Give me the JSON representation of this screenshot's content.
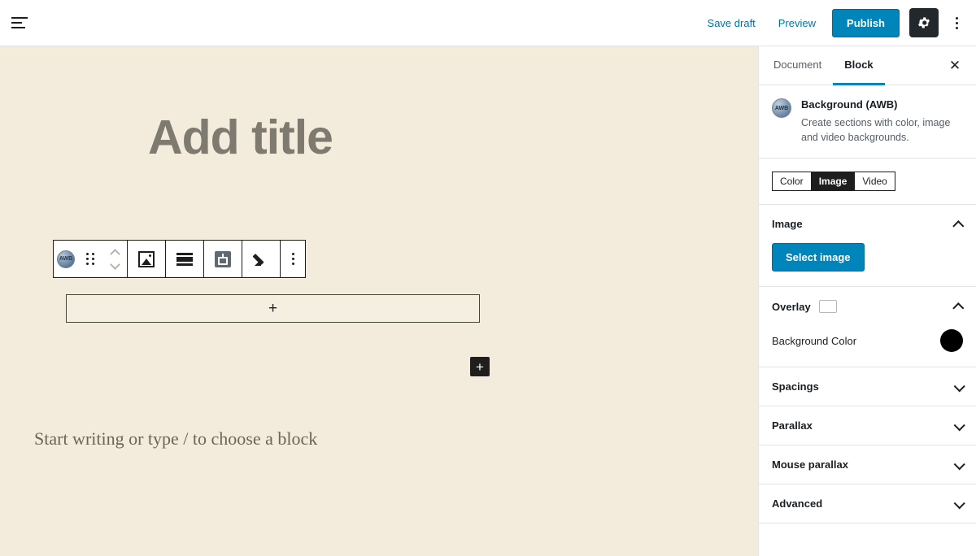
{
  "topbar": {
    "menu_icon": "hamburger-icon",
    "save_draft_label": "Save draft",
    "preview_label": "Preview",
    "publish_label": "Publish",
    "settings_icon": "gear-icon",
    "more_icon": "kebab-menu-icon"
  },
  "canvas": {
    "title_placeholder": "Add title",
    "inner_appender_glyph": "+",
    "dark_appender_glyph": "+",
    "paragraph_placeholder": "Start writing or type / to choose a block",
    "background_color": "#f3ecdd"
  },
  "block_toolbar": {
    "block_icon": "awb-block-icon",
    "block_icon_text": "AWB",
    "drag_handle_icon": "drag-handle-icon",
    "move_up_icon": "chevron-up-icon",
    "move_down_icon": "chevron-down-icon",
    "change_type_icon": "image-icon",
    "align_icon": "full-width-align-icon",
    "vertical_align_icon": "vertical-align-center-icon",
    "edit_icon": "pencil-icon",
    "options_icon": "kebab-menu-icon"
  },
  "sidebar": {
    "tabs": [
      {
        "label": "Document",
        "active": false
      },
      {
        "label": "Block",
        "active": true
      }
    ],
    "close_label": "✕",
    "block_card": {
      "icon_text": "AWB",
      "title": "Background (AWB)",
      "description": "Create sections with color, image and video backgrounds."
    },
    "segmented_control": {
      "options": [
        {
          "label": "Color",
          "active": false
        },
        {
          "label": "Image",
          "active": true
        },
        {
          "label": "Video",
          "active": false
        }
      ]
    },
    "image_panel": {
      "title": "Image",
      "expanded": true,
      "select_image_label": "Select image"
    },
    "overlay_panel": {
      "title": "Overlay",
      "expanded": true,
      "checkbox_checked": false,
      "background_color_label": "Background Color",
      "background_color_value": "#000000"
    },
    "accordions": [
      {
        "label": "Spacings",
        "expanded": false
      },
      {
        "label": "Parallax",
        "expanded": false
      },
      {
        "label": "Mouse parallax",
        "expanded": false
      },
      {
        "label": "Advanced",
        "expanded": false
      }
    ]
  },
  "colors": {
    "accent_blue": "#0085ba",
    "link_blue": "#0073aa",
    "canvas_bg": "#f3ecdd",
    "dark": "#1e1e1e"
  }
}
